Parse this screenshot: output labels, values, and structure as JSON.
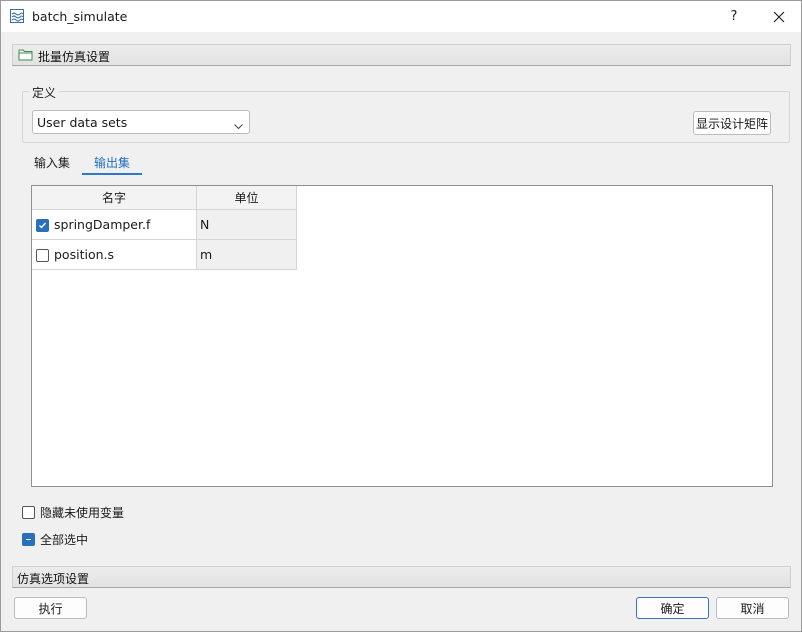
{
  "window": {
    "title": "batch_simulate",
    "help_label": "?"
  },
  "batch_section": {
    "label": "批量仿真设置"
  },
  "definition": {
    "group_title": "定义",
    "dataset_select": {
      "value": "User data sets"
    },
    "matrix_button": "显示设计矩阵"
  },
  "tabs": [
    {
      "label": "输入集",
      "selected": false
    },
    {
      "label": "输出集",
      "selected": true
    }
  ],
  "table": {
    "headers": {
      "name": "名字",
      "unit": "单位"
    },
    "rows": [
      {
        "name": "springDamper.f",
        "unit": "N",
        "checked": true
      },
      {
        "name": "position.s",
        "unit": "m",
        "checked": false
      }
    ]
  },
  "options": {
    "hide_unused": {
      "label": "隐藏未使用变量",
      "checked": false
    },
    "select_all": {
      "label": "全部选中",
      "state": "partial"
    }
  },
  "sim_section": {
    "label": "仿真选项设置"
  },
  "footer": {
    "run": "执行",
    "ok": "确定",
    "cancel": "取消"
  },
  "colors": {
    "accent": "#2a6fba",
    "tab_active": "#1f6fbf"
  }
}
